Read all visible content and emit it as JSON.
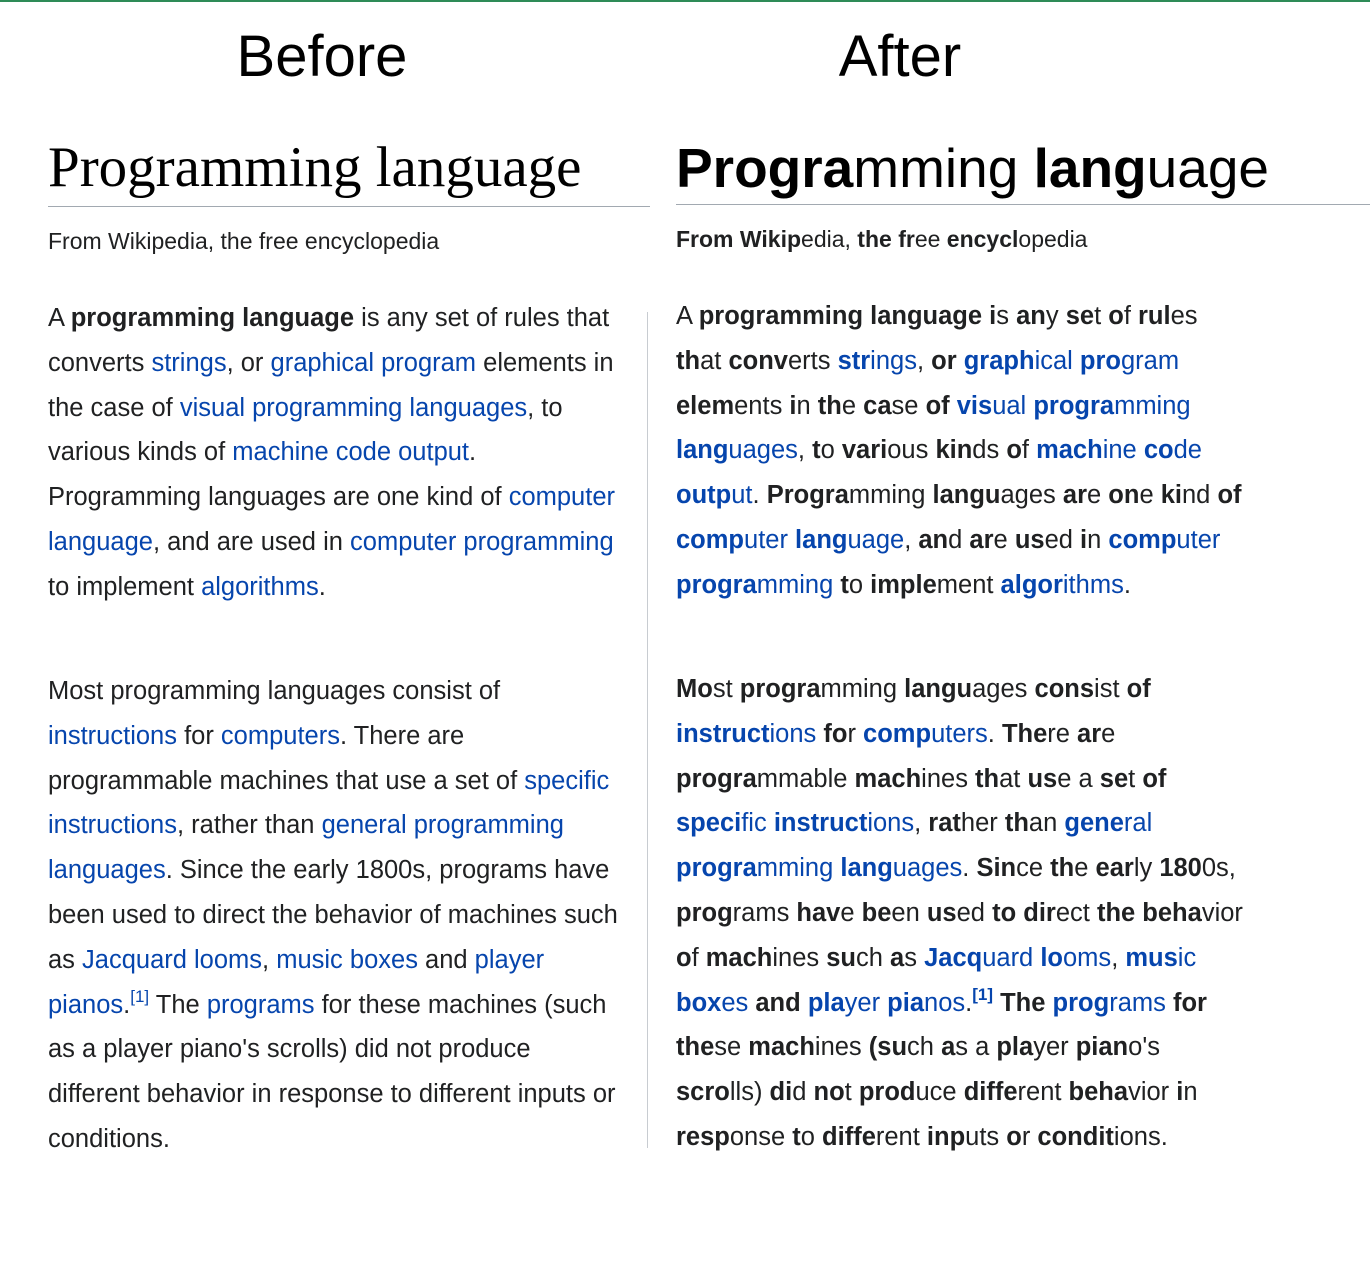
{
  "colors": {
    "link": "#0645ad",
    "text": "#202122",
    "rule": "#a2a9b1",
    "top_accent": "#2e8b57"
  },
  "before": {
    "heading": "Before",
    "title": "Programming language",
    "tagline": "From Wikipedia, the free encyclopedia",
    "p1": [
      {
        "t": "A "
      },
      {
        "t": "programming language",
        "strong": true
      },
      {
        "t": " is any set of rules that converts "
      },
      {
        "t": "strings",
        "link": true
      },
      {
        "t": ", or "
      },
      {
        "t": "graphical program",
        "link": true
      },
      {
        "t": " elements in the case of "
      },
      {
        "t": "visual programming languages",
        "link": true
      },
      {
        "t": ", to various kinds of "
      },
      {
        "t": "machine code output",
        "link": true
      },
      {
        "t": ". Programming languages are one kind of "
      },
      {
        "t": "computer language",
        "link": true
      },
      {
        "t": ", and are used in "
      },
      {
        "t": "computer programming",
        "link": true
      },
      {
        "t": " to implement "
      },
      {
        "t": "algorithms",
        "link": true
      },
      {
        "t": "."
      }
    ],
    "p2": [
      {
        "t": "Most programming languages consist of "
      },
      {
        "t": "instructions",
        "link": true
      },
      {
        "t": " for "
      },
      {
        "t": "computers",
        "link": true
      },
      {
        "t": ". There are programmable machines that use a set of "
      },
      {
        "t": "specific instructions",
        "link": true
      },
      {
        "t": ", rather than "
      },
      {
        "t": "general programming languages",
        "link": true
      },
      {
        "t": ". Since the early 1800s, programs have been used to direct the behavior of machines such as "
      },
      {
        "t": "Jacquard looms",
        "link": true
      },
      {
        "t": ", "
      },
      {
        "t": "music boxes",
        "link": true
      },
      {
        "t": " and "
      },
      {
        "t": "player pianos",
        "link": true
      },
      {
        "t": "."
      },
      {
        "t": "[1]",
        "link": true,
        "sup": true
      },
      {
        "t": " The "
      },
      {
        "t": "programs",
        "link": true
      },
      {
        "t": " for these machines (such as a player piano's scrolls) did not produce different behavior in response to different inputs or conditions."
      }
    ]
  },
  "after": {
    "heading": "After",
    "title": [
      {
        "t": "Progra",
        "b": true
      },
      {
        "t": "mming "
      },
      {
        "t": "lang",
        "b": true
      },
      {
        "t": "uage"
      }
    ],
    "tagline": [
      {
        "t": "From",
        "b": true
      },
      {
        "t": " "
      },
      {
        "t": "Wikip",
        "b": true
      },
      {
        "t": "edia, "
      },
      {
        "t": "the",
        "b": true
      },
      {
        "t": " "
      },
      {
        "t": "fr",
        "b": true
      },
      {
        "t": "ee "
      },
      {
        "t": "encycl",
        "b": true
      },
      {
        "t": "opedia"
      }
    ],
    "p1": [
      {
        "t": "A "
      },
      {
        "t": "programming language",
        "b": true
      },
      {
        "t": " "
      },
      {
        "t": "i",
        "b": true
      },
      {
        "t": "s "
      },
      {
        "t": "an",
        "b": true
      },
      {
        "t": "y "
      },
      {
        "t": "se",
        "b": true
      },
      {
        "t": "t "
      },
      {
        "t": "o",
        "b": true
      },
      {
        "t": "f "
      },
      {
        "t": "rul",
        "b": true
      },
      {
        "t": "es "
      },
      {
        "t": "th",
        "b": true
      },
      {
        "t": "at "
      },
      {
        "t": "conv",
        "b": true
      },
      {
        "t": "erts "
      },
      {
        "t": "str",
        "b": true,
        "link": true
      },
      {
        "t": "ings",
        "link": true
      },
      {
        "t": ", "
      },
      {
        "t": "or",
        "b": true
      },
      {
        "t": " "
      },
      {
        "t": "graph",
        "b": true,
        "link": true
      },
      {
        "t": "ical",
        "link": true
      },
      {
        "t": " ",
        "link": true
      },
      {
        "t": "pro",
        "b": true,
        "link": true
      },
      {
        "t": "gram",
        "link": true
      },
      {
        "t": " "
      },
      {
        "t": "elem",
        "b": true
      },
      {
        "t": "ents "
      },
      {
        "t": "i",
        "b": true
      },
      {
        "t": "n "
      },
      {
        "t": "th",
        "b": true
      },
      {
        "t": "e "
      },
      {
        "t": "ca",
        "b": true
      },
      {
        "t": "se "
      },
      {
        "t": "of",
        "b": true
      },
      {
        "t": " "
      },
      {
        "t": "vis",
        "b": true,
        "link": true
      },
      {
        "t": "ual",
        "link": true
      },
      {
        "t": " ",
        "link": true
      },
      {
        "t": "progra",
        "b": true,
        "link": true
      },
      {
        "t": "mming ",
        "link": true
      },
      {
        "t": "lang",
        "b": true,
        "link": true
      },
      {
        "t": "uages",
        "link": true
      },
      {
        "t": ", "
      },
      {
        "t": "t",
        "b": true
      },
      {
        "t": "o "
      },
      {
        "t": "vari",
        "b": true
      },
      {
        "t": "ous "
      },
      {
        "t": "kin",
        "b": true
      },
      {
        "t": "ds "
      },
      {
        "t": "o",
        "b": true
      },
      {
        "t": "f "
      },
      {
        "t": "mach",
        "b": true,
        "link": true
      },
      {
        "t": "ine ",
        "link": true
      },
      {
        "t": "co",
        "b": true,
        "link": true
      },
      {
        "t": "de ",
        "link": true
      },
      {
        "t": "outp",
        "b": true,
        "link": true
      },
      {
        "t": "ut",
        "link": true
      },
      {
        "t": ". "
      },
      {
        "t": "Progra",
        "b": true
      },
      {
        "t": "mming "
      },
      {
        "t": "langu",
        "b": true
      },
      {
        "t": "ages "
      },
      {
        "t": "ar",
        "b": true
      },
      {
        "t": "e "
      },
      {
        "t": "on",
        "b": true
      },
      {
        "t": "e "
      },
      {
        "t": "ki",
        "b": true
      },
      {
        "t": "nd "
      },
      {
        "t": "of",
        "b": true
      },
      {
        "t": " "
      },
      {
        "t": "comp",
        "b": true,
        "link": true
      },
      {
        "t": "uter ",
        "link": true
      },
      {
        "t": "lang",
        "b": true,
        "link": true
      },
      {
        "t": "uage",
        "link": true
      },
      {
        "t": ", "
      },
      {
        "t": "an",
        "b": true
      },
      {
        "t": "d "
      },
      {
        "t": "ar",
        "b": true
      },
      {
        "t": "e "
      },
      {
        "t": "us",
        "b": true
      },
      {
        "t": "ed "
      },
      {
        "t": "i",
        "b": true
      },
      {
        "t": "n "
      },
      {
        "t": "comp",
        "b": true,
        "link": true
      },
      {
        "t": "uter ",
        "link": true
      },
      {
        "t": "progra",
        "b": true,
        "link": true
      },
      {
        "t": "mming",
        "link": true
      },
      {
        "t": " "
      },
      {
        "t": "t",
        "b": true
      },
      {
        "t": "o "
      },
      {
        "t": "imple",
        "b": true
      },
      {
        "t": "ment "
      },
      {
        "t": "algor",
        "b": true,
        "link": true
      },
      {
        "t": "ithms",
        "link": true
      },
      {
        "t": "."
      }
    ],
    "p2": [
      {
        "t": "Mo",
        "b": true
      },
      {
        "t": "st "
      },
      {
        "t": "progra",
        "b": true
      },
      {
        "t": "mming "
      },
      {
        "t": "langu",
        "b": true
      },
      {
        "t": "ages "
      },
      {
        "t": "cons",
        "b": true
      },
      {
        "t": "ist "
      },
      {
        "t": "of",
        "b": true
      },
      {
        "t": " "
      },
      {
        "t": "instruct",
        "b": true,
        "link": true
      },
      {
        "t": "ions",
        "link": true
      },
      {
        "t": " "
      },
      {
        "t": "fo",
        "b": true
      },
      {
        "t": "r "
      },
      {
        "t": "comp",
        "b": true,
        "link": true
      },
      {
        "t": "uters",
        "link": true
      },
      {
        "t": ". "
      },
      {
        "t": "The",
        "b": true
      },
      {
        "t": "re "
      },
      {
        "t": "ar",
        "b": true
      },
      {
        "t": "e "
      },
      {
        "t": "progra",
        "b": true
      },
      {
        "t": "mmable "
      },
      {
        "t": "mach",
        "b": true
      },
      {
        "t": "ines "
      },
      {
        "t": "th",
        "b": true
      },
      {
        "t": "at "
      },
      {
        "t": "us",
        "b": true
      },
      {
        "t": "e a "
      },
      {
        "t": "se",
        "b": true
      },
      {
        "t": "t "
      },
      {
        "t": "of",
        "b": true
      },
      {
        "t": " "
      },
      {
        "t": "speci",
        "b": true,
        "link": true
      },
      {
        "t": "fic ",
        "link": true
      },
      {
        "t": "instruct",
        "b": true,
        "link": true
      },
      {
        "t": "ions",
        "link": true
      },
      {
        "t": ", "
      },
      {
        "t": "rat",
        "b": true
      },
      {
        "t": "her "
      },
      {
        "t": "th",
        "b": true
      },
      {
        "t": "an "
      },
      {
        "t": "gene",
        "b": true,
        "link": true
      },
      {
        "t": "ral ",
        "link": true
      },
      {
        "t": "progra",
        "b": true,
        "link": true
      },
      {
        "t": "mming ",
        "link": true
      },
      {
        "t": "lang",
        "b": true,
        "link": true
      },
      {
        "t": "uages",
        "link": true
      },
      {
        "t": ". "
      },
      {
        "t": "Sin",
        "b": true
      },
      {
        "t": "ce "
      },
      {
        "t": "th",
        "b": true
      },
      {
        "t": "e "
      },
      {
        "t": "ear",
        "b": true
      },
      {
        "t": "ly "
      },
      {
        "t": "180",
        "b": true
      },
      {
        "t": "0s, "
      },
      {
        "t": "prog",
        "b": true
      },
      {
        "t": "rams "
      },
      {
        "t": "hav",
        "b": true
      },
      {
        "t": "e "
      },
      {
        "t": "be",
        "b": true
      },
      {
        "t": "en "
      },
      {
        "t": "us",
        "b": true
      },
      {
        "t": "ed "
      },
      {
        "t": "to",
        "b": true
      },
      {
        "t": " "
      },
      {
        "t": "dir",
        "b": true
      },
      {
        "t": "ect "
      },
      {
        "t": "the",
        "b": true
      },
      {
        "t": " "
      },
      {
        "t": "beha",
        "b": true
      },
      {
        "t": "vior "
      },
      {
        "t": "o",
        "b": true
      },
      {
        "t": "f "
      },
      {
        "t": "mach",
        "b": true
      },
      {
        "t": "ines "
      },
      {
        "t": "su",
        "b": true
      },
      {
        "t": "ch "
      },
      {
        "t": "a",
        "b": true
      },
      {
        "t": "s "
      },
      {
        "t": "Jacq",
        "b": true,
        "link": true
      },
      {
        "t": "uard ",
        "link": true
      },
      {
        "t": "lo",
        "b": true,
        "link": true
      },
      {
        "t": "oms",
        "link": true
      },
      {
        "t": ", "
      },
      {
        "t": "mus",
        "b": true,
        "link": true
      },
      {
        "t": "ic ",
        "link": true
      },
      {
        "t": "box",
        "b": true,
        "link": true
      },
      {
        "t": "es",
        "link": true
      },
      {
        "t": " "
      },
      {
        "t": "and",
        "b": true
      },
      {
        "t": " "
      },
      {
        "t": "pla",
        "b": true,
        "link": true
      },
      {
        "t": "yer ",
        "link": true
      },
      {
        "t": "pia",
        "b": true,
        "link": true
      },
      {
        "t": "nos",
        "link": true
      },
      {
        "t": "."
      },
      {
        "t": "[1]",
        "b": true,
        "link": true,
        "sup": true
      },
      {
        "t": " "
      },
      {
        "t": "The",
        "b": true
      },
      {
        "t": " "
      },
      {
        "t": "prog",
        "b": true,
        "link": true
      },
      {
        "t": "rams",
        "link": true
      },
      {
        "t": " "
      },
      {
        "t": "for",
        "b": true
      },
      {
        "t": " "
      },
      {
        "t": "the",
        "b": true
      },
      {
        "t": "se "
      },
      {
        "t": "mach",
        "b": true
      },
      {
        "t": "ines "
      },
      {
        "t": "(su",
        "b": true
      },
      {
        "t": "ch "
      },
      {
        "t": "a",
        "b": true
      },
      {
        "t": "s a "
      },
      {
        "t": "pla",
        "b": true
      },
      {
        "t": "yer "
      },
      {
        "t": "pian",
        "b": true
      },
      {
        "t": "o's "
      },
      {
        "t": "scro",
        "b": true
      },
      {
        "t": "lls) "
      },
      {
        "t": "di",
        "b": true
      },
      {
        "t": "d "
      },
      {
        "t": "no",
        "b": true
      },
      {
        "t": "t "
      },
      {
        "t": "prod",
        "b": true
      },
      {
        "t": "uce "
      },
      {
        "t": "diffe",
        "b": true
      },
      {
        "t": "rent "
      },
      {
        "t": "beha",
        "b": true
      },
      {
        "t": "vior "
      },
      {
        "t": "i",
        "b": true
      },
      {
        "t": "n "
      },
      {
        "t": "resp",
        "b": true
      },
      {
        "t": "onse "
      },
      {
        "t": "t",
        "b": true
      },
      {
        "t": "o "
      },
      {
        "t": "diffe",
        "b": true
      },
      {
        "t": "rent "
      },
      {
        "t": "inp",
        "b": true
      },
      {
        "t": "uts "
      },
      {
        "t": "o",
        "b": true
      },
      {
        "t": "r "
      },
      {
        "t": "condit",
        "b": true
      },
      {
        "t": "ions."
      }
    ]
  }
}
